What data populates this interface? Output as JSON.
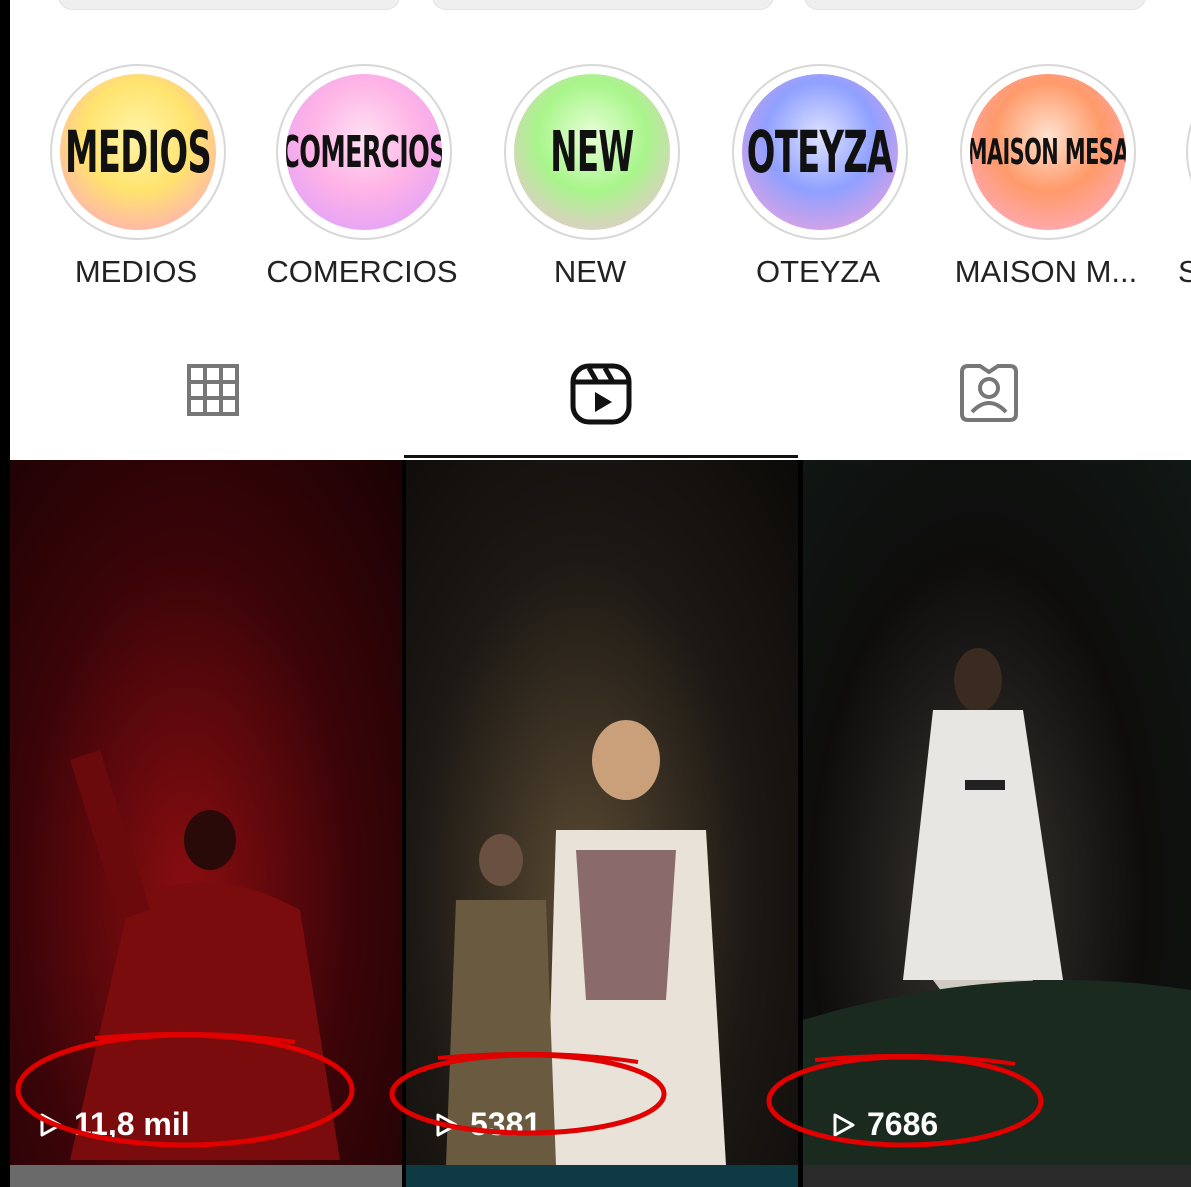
{
  "highlights": [
    {
      "cover_text": "MEDIOS",
      "label": "MEDIOS",
      "gradient": [
        "#ffe36e",
        "#ff9bcf",
        "#fff4a8"
      ]
    },
    {
      "cover_text": "COMERCIOS",
      "label": "COMERCIOS",
      "gradient": [
        "#ffb3e6",
        "#d59bff",
        "#fde0f3"
      ]
    },
    {
      "cover_text": "NEW",
      "label": "NEW",
      "gradient": [
        "#a8f58a",
        "#ffb8e8",
        "#e8ffd8"
      ]
    },
    {
      "cover_text": "OTEYZA",
      "label": "OTEYZA",
      "gradient": [
        "#8fa0ff",
        "#ffa3d9",
        "#dfe3ff"
      ]
    },
    {
      "cover_text": "MAISON MESA",
      "label": "MAISON M...",
      "gradient": [
        "#ff9a6a",
        "#ffb0d8",
        "#ffe2cf"
      ]
    },
    {
      "cover_text": "",
      "label": "S",
      "gradient": [
        "#ffffff",
        "#eeeeee",
        "#ffffff"
      ]
    }
  ],
  "tabs": [
    {
      "icon": "grid-icon",
      "active": false
    },
    {
      "icon": "reels-icon",
      "active": true
    },
    {
      "icon": "tagged-icon",
      "active": false
    }
  ],
  "reels": [
    {
      "views": "11,8 mil",
      "palette": [
        "#3a0408",
        "#8a0d10",
        "#1a0204"
      ]
    },
    {
      "views": "5381",
      "palette": [
        "#1c1814",
        "#5a4a32",
        "#0c0a08"
      ]
    },
    {
      "views": "7686",
      "palette": [
        "#0e0d0c",
        "#3a3632",
        "#101815"
      ]
    }
  ],
  "annotation_color": "#e00000"
}
